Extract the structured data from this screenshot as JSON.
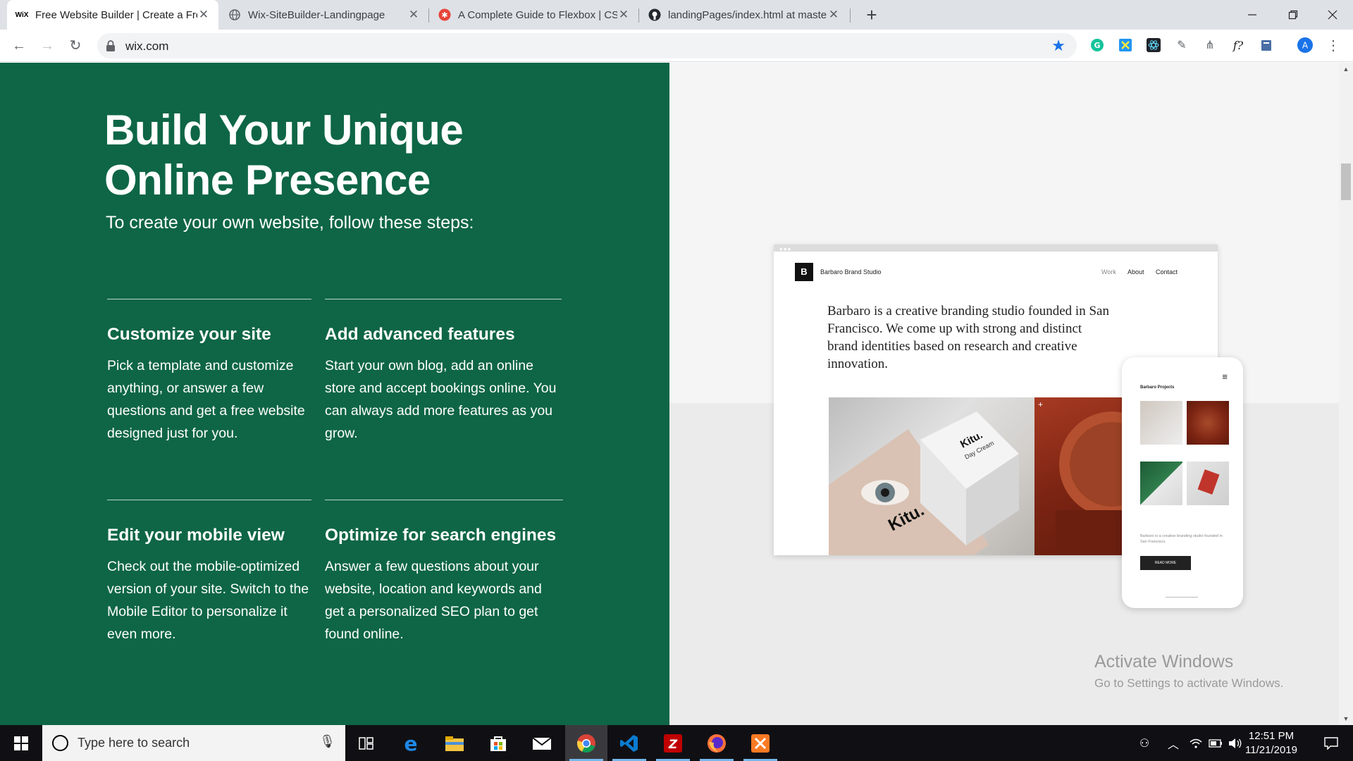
{
  "browser": {
    "tabs": [
      {
        "title": "Free Website Builder | Create a Free Website",
        "favicon": "wix-icon",
        "active": true
      },
      {
        "title": "Wix-SiteBuilder-Landingpage",
        "favicon": "globe-icon",
        "active": false
      },
      {
        "title": "A Complete Guide to Flexbox | CSS-Tricks",
        "favicon": "css-tricks-icon",
        "active": false
      },
      {
        "title": "landingPages/index.html at master",
        "favicon": "github-icon",
        "active": false
      }
    ],
    "favicon_wix_text": "WiX",
    "url": "wix.com"
  },
  "hero": {
    "title_line1": "Build Your Unique",
    "title_line2": "Online Presence",
    "subtitle": "To create your own website, follow these steps:"
  },
  "features": [
    {
      "title": "Customize your site",
      "text": "Pick a template and customize anything, or answer a few questions and get a free website designed just for you."
    },
    {
      "title": "Add advanced features",
      "text": "Start your own blog, add an online store and accept bookings online. You can always add more features as you grow."
    },
    {
      "title": "Edit your mobile view",
      "text": "Check out the mobile-optimized version of your site. Switch to the Mobile Editor to personalize it even more."
    },
    {
      "title": "Optimize for search engines",
      "text": "Answer a few questions about your website, location and keywords and get a personalized SEO plan to get found online."
    }
  ],
  "mockup": {
    "logo": "B",
    "brand": "Barbaro Brand Studio",
    "nav": [
      "Work",
      "About",
      "Contact"
    ],
    "lead": "Barbaro is a creative branding studio founded in San Francisco. We come up with strong and distinct brand identities based on research and creative innovation.",
    "product_text": "Kitu.",
    "product_sub": "Day Cream",
    "phone_title": "Barbaro Projects",
    "phone_text": "Barbaro is a creative branding studio founded in San Francisco.",
    "phone_button": "READ MORE"
  },
  "watermark": {
    "line1": "Activate Windows",
    "line2": "Go to Settings to activate Windows."
  },
  "taskbar": {
    "search_placeholder": "Type here to search",
    "time": "12:51 PM",
    "date": "11/21/2019"
  },
  "colors": {
    "green_panel": "#0e6646",
    "chrome_tabstrip": "#dee1e6",
    "taskbar": "#101014"
  }
}
